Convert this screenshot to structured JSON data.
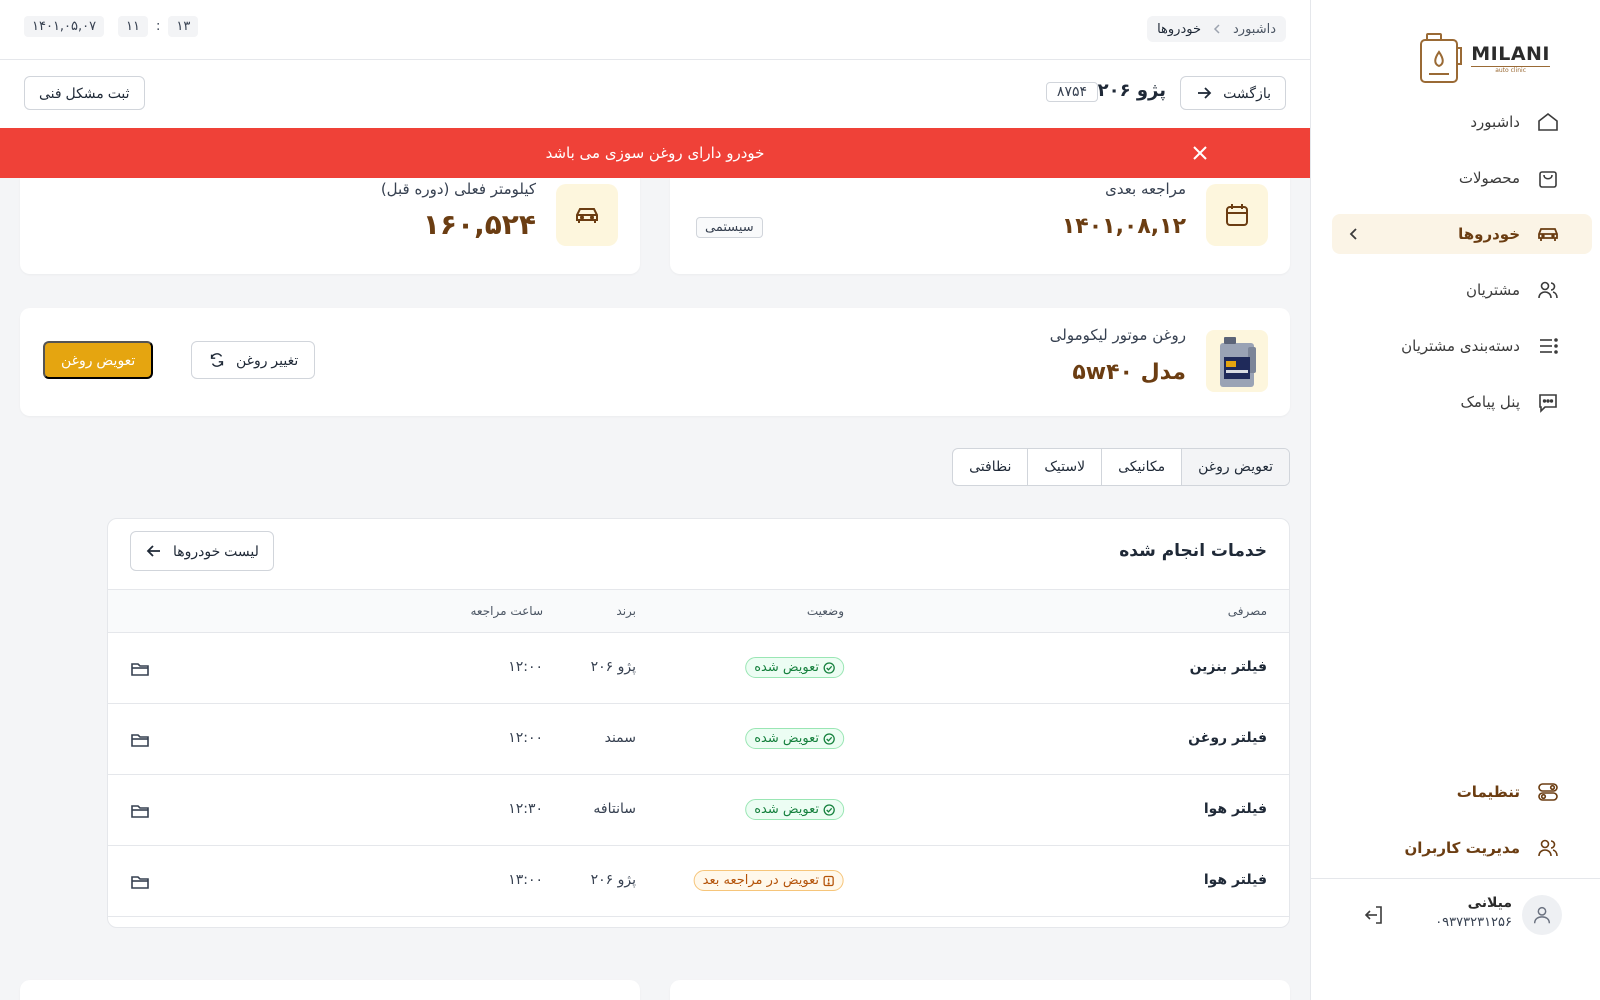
{
  "brand": {
    "logo_text": "MILANI",
    "logo_sub": "auto clinic"
  },
  "sidebar": {
    "items": [
      {
        "label": "داشبورد",
        "icon": "home-icon"
      },
      {
        "label": "محصولات",
        "icon": "bag-icon"
      },
      {
        "label": "خودروها",
        "icon": "car-icon",
        "active": true
      },
      {
        "label": "مشتریان",
        "icon": "users-icon"
      },
      {
        "label": "دسته‌بندی مشتریان",
        "icon": "list-icon"
      },
      {
        "label": "پنل پیامک",
        "icon": "chat-icon"
      }
    ],
    "bottom_items": [
      {
        "label": "تنظیمات",
        "icon": "settings-icon"
      },
      {
        "label": "مدیریت کاربران",
        "icon": "users-manage-icon"
      }
    ],
    "user": {
      "name": "میلانی",
      "phone": "۰۹۳۷۳۲۳۱۲۵۶"
    }
  },
  "topbar": {
    "breadcrumb": [
      "داشبورد",
      "خودروها"
    ],
    "clock": {
      "hour": "۱۳",
      "minute": "۱۱"
    },
    "date": "۱۴۰۱,۰۵,۰۷"
  },
  "header": {
    "back_label": "بازگشت",
    "car_name": "پژو ۲۰۶",
    "plate": "۸۷۵۴",
    "tech_issue_label": "ثبت مشکل فنی"
  },
  "alert": {
    "text": "خودرو دارای روغن سوزی می باشد",
    "color": "#ef4138"
  },
  "stats": {
    "next_visit": {
      "label": "مراجعه بعدی",
      "value": "۱۴۰۱,۰۸,۱۲",
      "tag": "سیستمی"
    },
    "mileage": {
      "label": "کیلومتر فعلی (دوره قبل)",
      "value": "۱۶۰,۵۲۴"
    }
  },
  "oil": {
    "name": "روغن موتور لیکومولی",
    "model": "مدل ۵w۴۰",
    "change_label": "تغییر روغن",
    "replace_label": "تعویض روغن"
  },
  "tabs": [
    "تعویض روغن",
    "مکانیکی",
    "لاستیک",
    "نظافتی"
  ],
  "services": {
    "title": "خدمات انجام شده",
    "list_button": "لیست خودروها",
    "columns": {
      "item": "مصرفی",
      "status": "وضعیت",
      "brand": "برند",
      "time": "ساعت مراجعه"
    },
    "rows": [
      {
        "item": "فیلتر بنزین",
        "status": "تعویض شده",
        "status_type": "ok",
        "brand": "پژو ۲۰۶",
        "time": "۱۲:۰۰"
      },
      {
        "item": "فیلتر روغن",
        "status": "تعویض شده",
        "status_type": "ok",
        "brand": "سمند",
        "time": "۱۲:۰۰"
      },
      {
        "item": "فیلتر هوا",
        "status": "تعویض شده",
        "status_type": "ok",
        "brand": "سانتافه",
        "time": "۱۲:۳۰"
      },
      {
        "item": "فیلتر هوا",
        "status": "تعویض در مراجعه بعد",
        "status_type": "pending",
        "brand": "پژو ۲۰۶",
        "time": "۱۳:۰۰"
      }
    ]
  },
  "colors": {
    "brand_brown": "#6b3d12",
    "primary_yellow": "#e5a510",
    "danger": "#ef4138"
  }
}
